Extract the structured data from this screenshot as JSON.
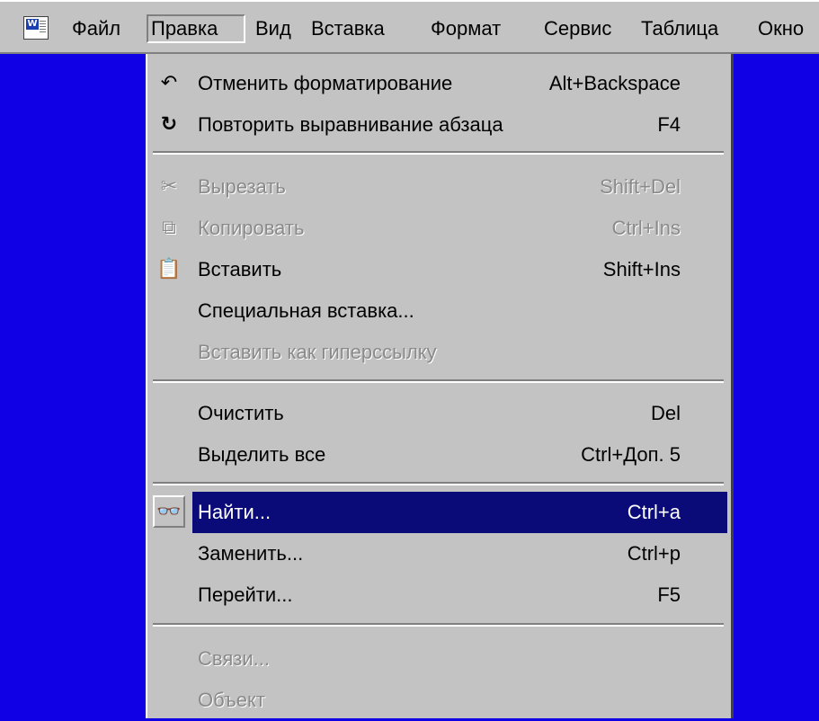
{
  "menubar": {
    "items": [
      "Файл",
      "Правка",
      "Вид",
      "Вставка",
      "Формат",
      "Сервис",
      "Таблица",
      "Окно"
    ]
  },
  "dropdown": {
    "items": [
      {
        "label": "Отменить форматирование",
        "shortcut": "Alt+Backspace",
        "icon": "undo-icon",
        "state": "enabled"
      },
      {
        "label": "Повторить выравнивание абзаца",
        "shortcut": "F4",
        "icon": "redo-icon",
        "state": "enabled"
      },
      {
        "label": "Вырезать",
        "shortcut": "Shift+Del",
        "icon": "scissors-icon",
        "state": "disabled"
      },
      {
        "label": "Копировать",
        "shortcut": "Ctrl+Ins",
        "icon": "copy-icon",
        "state": "disabled"
      },
      {
        "label": "Вставить",
        "shortcut": "Shift+Ins",
        "icon": "paste-icon",
        "state": "enabled"
      },
      {
        "label": "Специальная вставка...",
        "shortcut": "",
        "icon": "",
        "state": "enabled"
      },
      {
        "label": "Вставить как гиперссылку",
        "shortcut": "",
        "icon": "",
        "state": "disabled"
      },
      {
        "label": "Очистить",
        "shortcut": "Del",
        "icon": "",
        "state": "enabled"
      },
      {
        "label": "Выделить все",
        "shortcut": "Ctrl+Доп. 5",
        "icon": "",
        "state": "enabled"
      },
      {
        "label": "Найти...",
        "shortcut": "Ctrl+a",
        "icon": "binoculars-icon",
        "state": "highlighted"
      },
      {
        "label": "Заменить...",
        "shortcut": "Ctrl+p",
        "icon": "",
        "state": "enabled"
      },
      {
        "label": "Перейти...",
        "shortcut": "F5",
        "icon": "",
        "state": "enabled"
      },
      {
        "label": "Связи...",
        "shortcut": "",
        "icon": "",
        "state": "disabled"
      },
      {
        "label": "Объект",
        "shortcut": "",
        "icon": "",
        "state": "disabled"
      }
    ]
  },
  "colors": {
    "desktop": "#0f00e6",
    "menu_face": "#c3c3c3",
    "highlight": "#0a0a78"
  }
}
